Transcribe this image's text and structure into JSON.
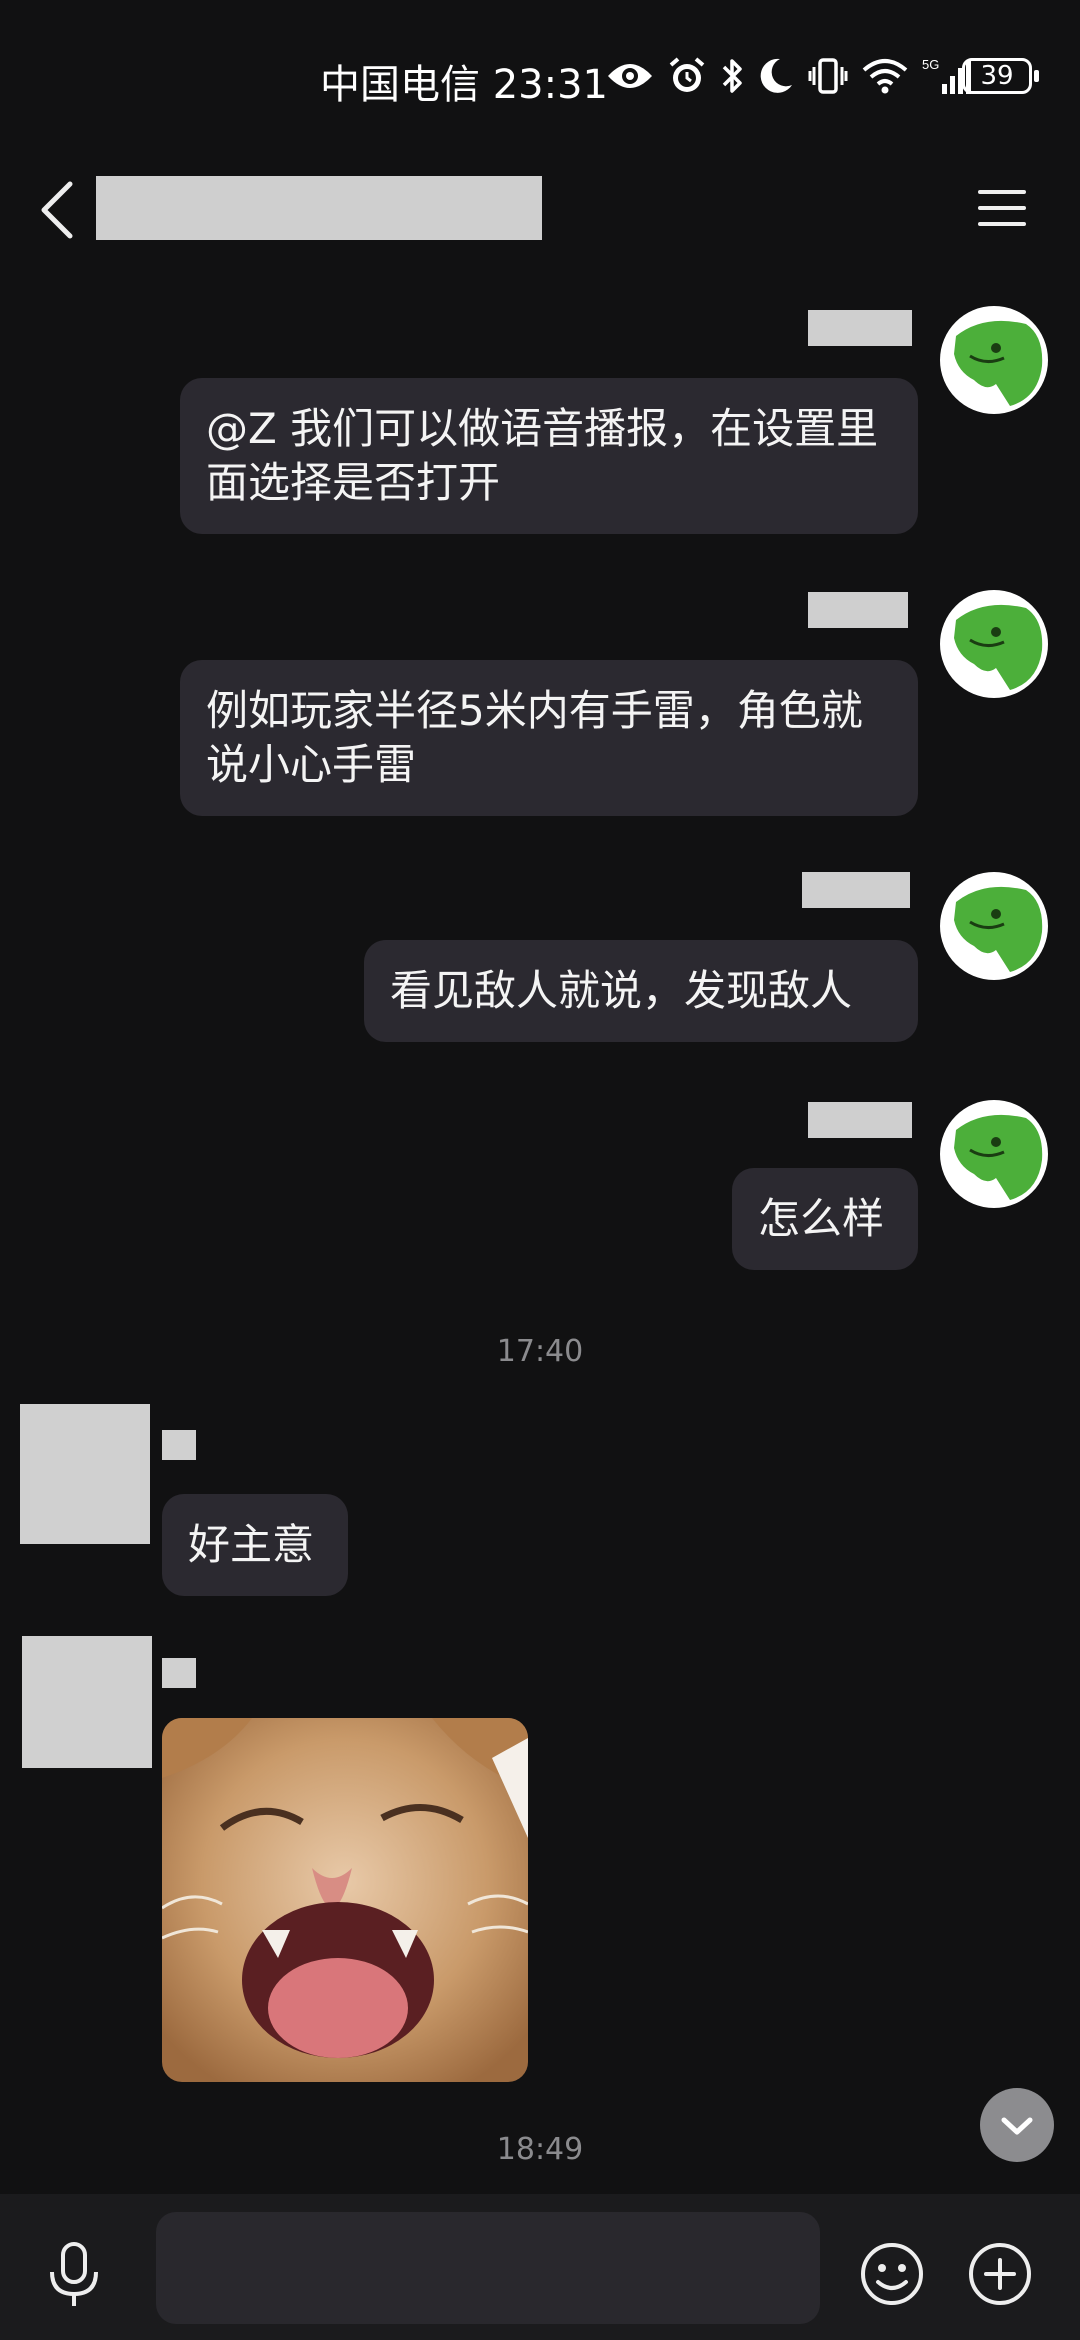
{
  "status_bar": {
    "carrier_time": "中国电信 23:31",
    "network": "5G",
    "battery": "39"
  },
  "header": {
    "back_icon": "chevron-left-icon",
    "menu_icon": "hamburger-menu-icon"
  },
  "messages": [
    {
      "side": "right",
      "text": "@Z 我们可以做语音播报，在设置里面选择是否打开"
    },
    {
      "side": "right",
      "text": "例如玩家半径5米内有手雷，角色就说小心手雷"
    },
    {
      "side": "right",
      "text": "看见敌人就说，发现敌人"
    },
    {
      "side": "right",
      "text": "怎么样"
    },
    {
      "side": "left",
      "text": "好主意"
    },
    {
      "side": "left",
      "type": "sticker",
      "description": "laughing-cat-sticker"
    }
  ],
  "timestamps": [
    "17:40",
    "18:49"
  ],
  "input": {
    "placeholder": "",
    "voice_icon": "microphone-icon",
    "emoji_icon": "smiley-icon",
    "plus_icon": "plus-circle-icon"
  },
  "colors": {
    "background": "#111112",
    "bubble": "#2b2930",
    "input_bar": "#1b1b1d",
    "timestamp": "#8b8b8e"
  }
}
